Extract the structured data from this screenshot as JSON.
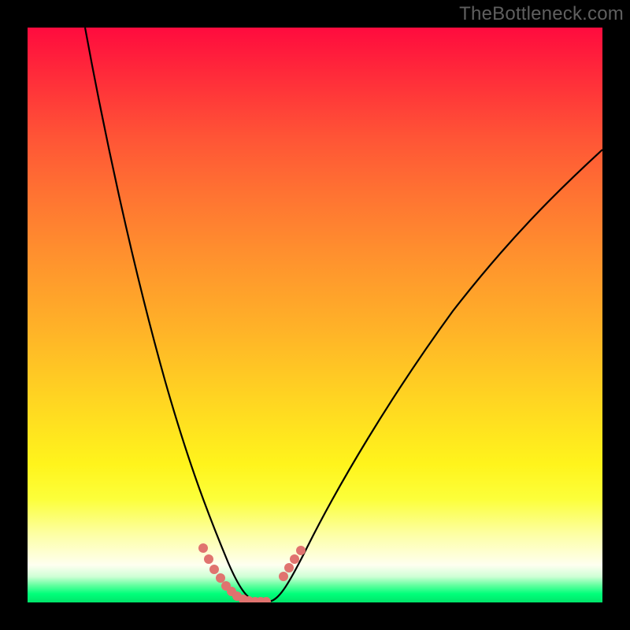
{
  "watermark": "TheBottleneck.com",
  "chart_data": {
    "type": "line",
    "title": "",
    "xlabel": "",
    "ylabel": "",
    "xlim": [
      0,
      100
    ],
    "ylim": [
      0,
      100
    ],
    "grid": false,
    "legend": false,
    "series": [
      {
        "name": "left-curve",
        "x": [
          10,
          12,
          15,
          18,
          21,
          24,
          27,
          30,
          33,
          35,
          37,
          38
        ],
        "y": [
          100,
          87,
          70,
          55,
          42,
          30,
          20,
          12,
          6,
          2,
          0,
          0
        ]
      },
      {
        "name": "right-curve",
        "x": [
          42,
          44,
          47,
          52,
          58,
          65,
          73,
          82,
          91,
          100
        ],
        "y": [
          0,
          2,
          8,
          17,
          28,
          40,
          52,
          62,
          71,
          79
        ]
      },
      {
        "name": "left-marker-cluster",
        "x": [
          30.5,
          31.5,
          32.5,
          33.5,
          34.5,
          35.5,
          36.5,
          37.5,
          38.5,
          39.5,
          40.5,
          41.5
        ],
        "y": [
          9.5,
          7.5,
          5.7,
          4.2,
          2.9,
          1.9,
          1.1,
          0.5,
          0.2,
          0.1,
          0.1,
          0.1
        ]
      },
      {
        "name": "right-marker-cluster",
        "x": [
          44.5,
          45.5,
          46.5,
          47.5
        ],
        "y": [
          4.5,
          6.0,
          7.5,
          9.0
        ]
      }
    ],
    "colors": {
      "curve": "#000000",
      "marker": "#e0736f",
      "gradient_top": "#ff0b3e",
      "gradient_bottom": "#00e46a"
    }
  }
}
